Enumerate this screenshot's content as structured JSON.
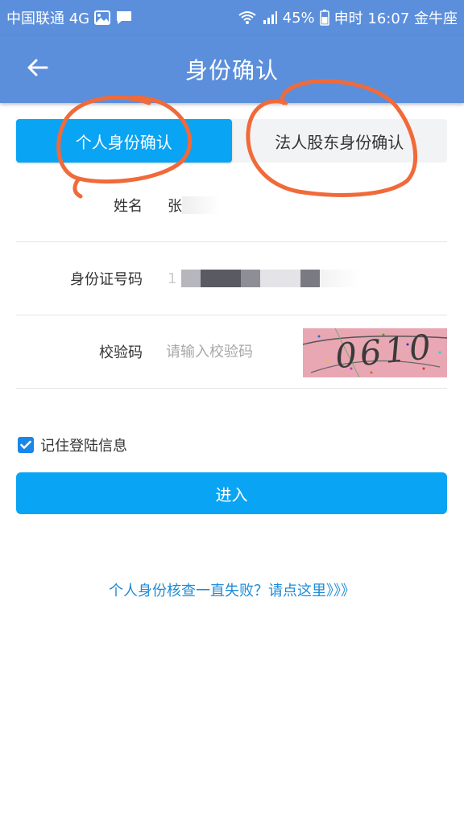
{
  "status_bar": {
    "carrier": "中国联通 4G",
    "battery": "45%",
    "time_text": "申时 16:07 金牛座"
  },
  "header": {
    "title": "身份确认"
  },
  "tabs": [
    {
      "label": "个人身份确认",
      "active": true
    },
    {
      "label": "法人股东身份确认",
      "active": false
    }
  ],
  "form": {
    "name": {
      "label": "姓名",
      "value": "张"
    },
    "id_number": {
      "label": "身份证号码",
      "value": "1"
    },
    "verify_code": {
      "label": "校验码",
      "placeholder": "请输入校验码",
      "captcha_text": "0610"
    }
  },
  "remember": {
    "label": "记住登陆信息",
    "checked": true
  },
  "enter_button": {
    "label": "进入"
  },
  "help_link": {
    "text": "个人身份核查一直失败？请点这里》》》"
  },
  "colors": {
    "header": "#5b8fdc",
    "accent": "#0aa4f4",
    "link": "#1e8bd6",
    "annotation": "#f06a3a"
  },
  "icons": [
    "image-icon",
    "message-icon",
    "wifi-icon",
    "signal-icon",
    "battery-icon",
    "back-arrow-icon",
    "checkbox-check-icon"
  ]
}
